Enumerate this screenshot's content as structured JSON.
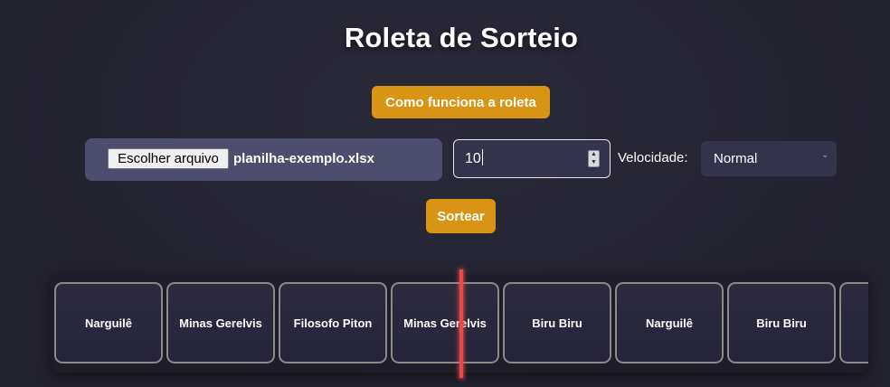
{
  "page": {
    "title": "Roleta de Sorteio"
  },
  "help_button": {
    "label": "Como funciona a roleta"
  },
  "file_picker": {
    "button_label": "Escolher arquivo",
    "file_name": "planilha-exemplo.xlsx"
  },
  "quantity": {
    "value": "10"
  },
  "speed": {
    "label": "Velocidade:",
    "selected": "Normal"
  },
  "draw_button": {
    "label": "Sortear"
  },
  "roulette": {
    "items": [
      "Narguilê",
      "Minas Gerelvis",
      "Filosofo Piton",
      "Minas Gerelvis",
      "Biru Biru",
      "Narguilê",
      "Biru Biru",
      ""
    ]
  },
  "colors": {
    "background": "#23222f",
    "accent": "#d99416",
    "pointer": "#e84a4a"
  }
}
